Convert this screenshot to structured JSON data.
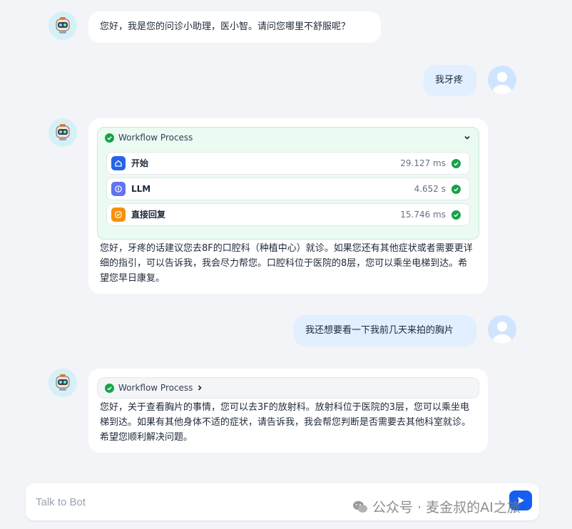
{
  "messages": [
    {
      "role": "bot",
      "text": "您好，我是您的问诊小助理，医小智。请问您哪里不舒服呢？"
    },
    {
      "role": "user",
      "text": "我牙疼"
    },
    {
      "role": "bot",
      "workflow": {
        "label": "Workflow Process",
        "nodes": [
          {
            "name": "开始",
            "time": "29.127 ms",
            "icon": "home-icon",
            "color": "#2563eb"
          },
          {
            "name": "LLM",
            "time": "4.652 s",
            "icon": "llm-icon",
            "color": "#6172f3"
          },
          {
            "name": "直接回复",
            "time": "15.746 ms",
            "icon": "reply-icon",
            "color": "#f79009"
          }
        ]
      },
      "text": "您好，牙疼的话建议您去8F的口腔科（种植中心）就诊。如果您还有其他症状或者需要更详细的指引，可以告诉我，我会尽力帮您。口腔科位于医院的8层，您可以乘坐电梯到达。希望您早日康复。"
    },
    {
      "role": "user",
      "text": "我还想要看一下我前几天来拍的胸片"
    },
    {
      "role": "bot",
      "workflow": {
        "label": "Workflow Process"
      },
      "text": "您好，关于查看胸片的事情，您可以去3F的放射科。放射科位于医院的3层，您可以乘坐电梯到达。如果有其他身体不适的症状，请告诉我，我会帮您判断是否需要去其他科室就诊。希望您顺利解决问题。"
    }
  ],
  "input": {
    "placeholder": "Talk to Bot"
  },
  "watermark": "公众号 · 麦金叔的AI之旅",
  "colors": {
    "success": "#16a34a",
    "send": "#155eef",
    "user_bubble": "#e1efff"
  }
}
